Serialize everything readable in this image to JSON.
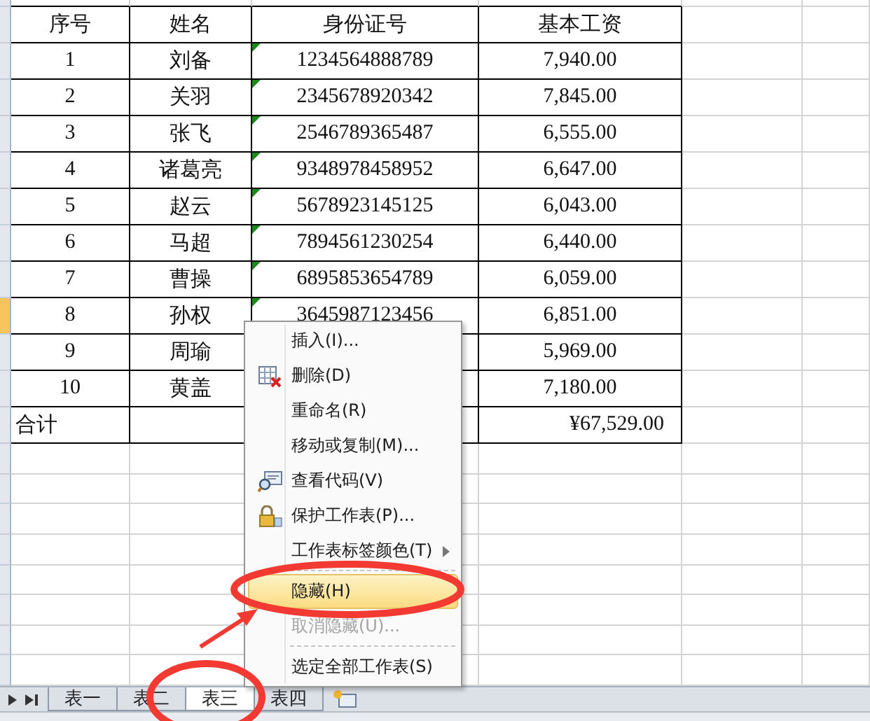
{
  "columns": [
    "序号",
    "姓名",
    "身份证号",
    "基本工资"
  ],
  "rows": [
    {
      "no": "1",
      "name": "刘备",
      "id": "1234564888789",
      "salary": "7,940.00",
      "text_flag": true,
      "active": false
    },
    {
      "no": "2",
      "name": "关羽",
      "id": "2345678920342",
      "salary": "7,845.00",
      "text_flag": true,
      "active": false
    },
    {
      "no": "3",
      "name": "张飞",
      "id": "2546789365487",
      "salary": "6,555.00",
      "text_flag": true,
      "active": false
    },
    {
      "no": "4",
      "name": "诸葛亮",
      "id": "9348978458952",
      "salary": "6,647.00",
      "text_flag": true,
      "active": false
    },
    {
      "no": "5",
      "name": "赵云",
      "id": "5678923145125",
      "salary": "6,043.00",
      "text_flag": true,
      "active": false
    },
    {
      "no": "6",
      "name": "马超",
      "id": "7894561230254",
      "salary": "6,440.00",
      "text_flag": true,
      "active": false
    },
    {
      "no": "7",
      "name": "曹操",
      "id": "6895853654789",
      "salary": "6,059.00",
      "text_flag": true,
      "active": false
    },
    {
      "no": "8",
      "name": "孙权",
      "id": "3645987123456",
      "salary": "6,851.00",
      "text_flag": true,
      "active": true
    },
    {
      "no": "9",
      "name": "周瑜",
      "salary": "5,969.00",
      "text_flag": false,
      "active": false
    },
    {
      "no": "10",
      "name": "黄盖",
      "salary": "7,180.00",
      "text_flag": false,
      "active": false
    }
  ],
  "total": {
    "label": "合计",
    "salary": "¥67,529.00"
  },
  "context_menu": {
    "items": [
      {
        "kind": "item",
        "label": "插入(I)...",
        "disabled": false,
        "selected": false,
        "submenu": false
      },
      {
        "kind": "item",
        "label": "删除(D)",
        "disabled": false,
        "selected": false,
        "submenu": false
      },
      {
        "kind": "item",
        "label": "重命名(R)",
        "disabled": false,
        "selected": false,
        "submenu": false
      },
      {
        "kind": "item",
        "label": "移动或复制(M)...",
        "disabled": false,
        "selected": false,
        "submenu": false
      },
      {
        "kind": "item",
        "label": "查看代码(V)",
        "disabled": false,
        "selected": false,
        "submenu": false
      },
      {
        "kind": "item",
        "label": "保护工作表(P)...",
        "disabled": false,
        "selected": false,
        "submenu": false
      },
      {
        "kind": "item",
        "label": "工作表标签颜色(T)",
        "disabled": false,
        "selected": false,
        "submenu": true
      },
      {
        "kind": "separator"
      },
      {
        "kind": "item",
        "label": "隐藏(H)",
        "disabled": false,
        "selected": true,
        "submenu": false
      },
      {
        "kind": "item",
        "label": "取消隐藏(U)...",
        "disabled": true,
        "selected": false,
        "submenu": false
      },
      {
        "kind": "separator"
      },
      {
        "kind": "item",
        "label": "选定全部工作表(S)",
        "disabled": false,
        "selected": false,
        "submenu": false
      }
    ]
  },
  "sheet_tabs": [
    {
      "label": "表一",
      "selected": false
    },
    {
      "label": "表二",
      "selected": false
    },
    {
      "label": "表三",
      "selected": true
    },
    {
      "label": "表四",
      "selected": false
    }
  ]
}
